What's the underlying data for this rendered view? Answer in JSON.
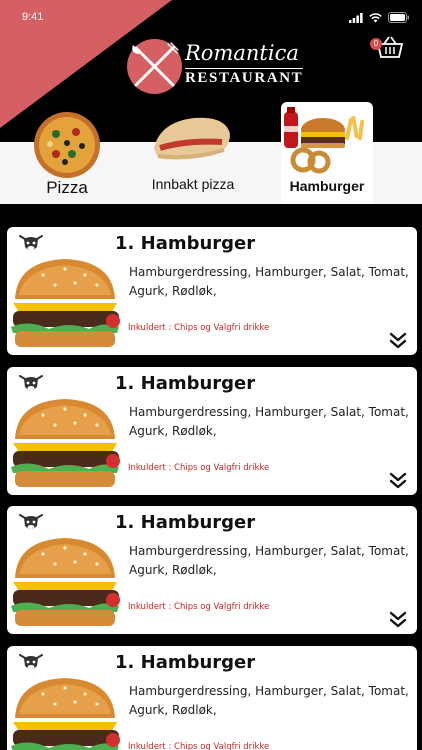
{
  "status": {
    "time": "9:41"
  },
  "brand": {
    "name": "Romantica",
    "subtitle": "RESTAURANT"
  },
  "cart": {
    "count": "0"
  },
  "categories": [
    {
      "label": "Pizza",
      "icon": "pizza-icon"
    },
    {
      "label": "Innbakt pizza",
      "icon": "calzone-icon"
    },
    {
      "label": "Hamburger",
      "icon": "burger-meal-icon",
      "active": true
    }
  ],
  "items": [
    {
      "title": "1. Hamburger",
      "desc": "Hamburgerdressing, Hamburger, Salat, Tomat, Agurk, Rødløk,",
      "included": "Inkuldert : Chips og Valgfri drikke"
    },
    {
      "title": "1. Hamburger",
      "desc": "Hamburgerdressing, Hamburger, Salat, Tomat, Agurk, Rødløk,",
      "included": "Inkuldert : Chips og Valgfri drikke"
    },
    {
      "title": "1. Hamburger",
      "desc": "Hamburgerdressing, Hamburger, Salat, Tomat, Agurk, Rødløk,",
      "included": "Inkuldert : Chips og Valgfri drikke"
    },
    {
      "title": "1. Hamburger",
      "desc": "Hamburgerdressing, Hamburger, Salat, Tomat, Agurk, Rødløk,",
      "included": "Inkuldert : Chips og Valgfri drikke"
    }
  ],
  "colors": {
    "accent": "#d46064",
    "included_text": "#c62828"
  }
}
